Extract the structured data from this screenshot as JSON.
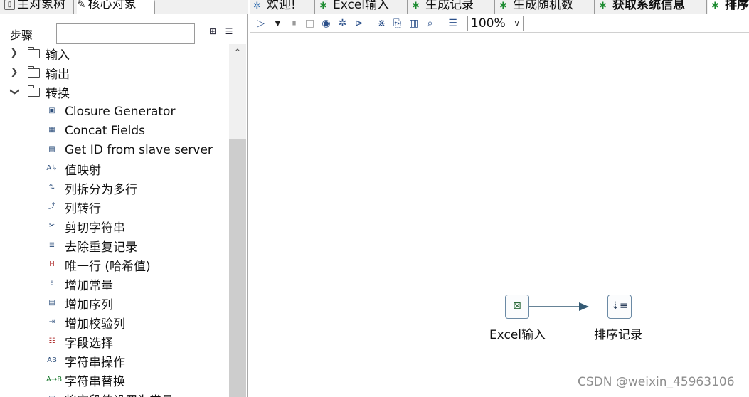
{
  "left_panel": {
    "tabs": [
      {
        "label": "主对象树",
        "icon": "tree-icon"
      },
      {
        "label": "核心对象",
        "icon": "pencil-icon"
      }
    ],
    "steps_label": "步骤",
    "search": {
      "value": "",
      "placeholder": ""
    },
    "folders": [
      {
        "label": "输入",
        "expanded": false
      },
      {
        "label": "输出",
        "expanded": false
      },
      {
        "label": "转换",
        "expanded": true
      }
    ],
    "transform_items": [
      {
        "label": "Closure Generator",
        "icon": "closure-generator-icon"
      },
      {
        "label": "Concat Fields",
        "icon": "concat-fields-icon"
      },
      {
        "label": "Get ID from slave server",
        "icon": "slave-id-icon"
      },
      {
        "label": "值映射",
        "icon": "value-mapper-icon"
      },
      {
        "label": "列拆分为多行",
        "icon": "split-rows-icon"
      },
      {
        "label": "列转行",
        "icon": "denormaliser-icon"
      },
      {
        "label": "剪切字符串",
        "icon": "scissors-icon"
      },
      {
        "label": "去除重复记录",
        "icon": "unique-rows-icon"
      },
      {
        "label": "唯一行 (哈希值)",
        "icon": "unique-hash-icon"
      },
      {
        "label": "增加常量",
        "icon": "constant-icon"
      },
      {
        "label": "增加序列",
        "icon": "sequence-icon"
      },
      {
        "label": "增加校验列",
        "icon": "checksum-icon"
      },
      {
        "label": "字段选择",
        "icon": "select-values-icon"
      },
      {
        "label": "字符串操作",
        "icon": "string-operations-icon"
      },
      {
        "label": "字符串替换",
        "icon": "replace-string-icon"
      },
      {
        "label": "将字段值设置为常量",
        "icon": "set-constant-icon"
      }
    ]
  },
  "editor": {
    "tabs": [
      {
        "label": "欢迎!",
        "icon": "welcome-icon",
        "bold": false
      },
      {
        "label": "Excel输入",
        "icon": "transformation-icon",
        "bold": false
      },
      {
        "label": "生成记录",
        "icon": "transformation-icon",
        "bold": false
      },
      {
        "label": "生成随机数",
        "icon": "transformation-icon",
        "bold": false
      },
      {
        "label": "获取系统信息",
        "icon": "transformation-icon",
        "bold": true
      },
      {
        "label": "排序",
        "icon": "transformation-icon",
        "bold": true
      }
    ],
    "toolbar": {
      "zoom": "100%",
      "buttons": [
        "run-icon",
        "run-dropdown-icon",
        "pause-icon",
        "stop-icon",
        "preview-icon",
        "debug-icon",
        "replay-icon",
        "verify-icon",
        "impact-icon",
        "sql-icon",
        "explore-db-icon",
        "results-icon"
      ]
    },
    "canvas": {
      "steps": [
        {
          "label": "Excel输入",
          "icon": "excel-input-icon"
        },
        {
          "label": "排序记录",
          "icon": "sort-rows-icon"
        }
      ]
    }
  },
  "watermark": "CSDN @weixin_45963106"
}
